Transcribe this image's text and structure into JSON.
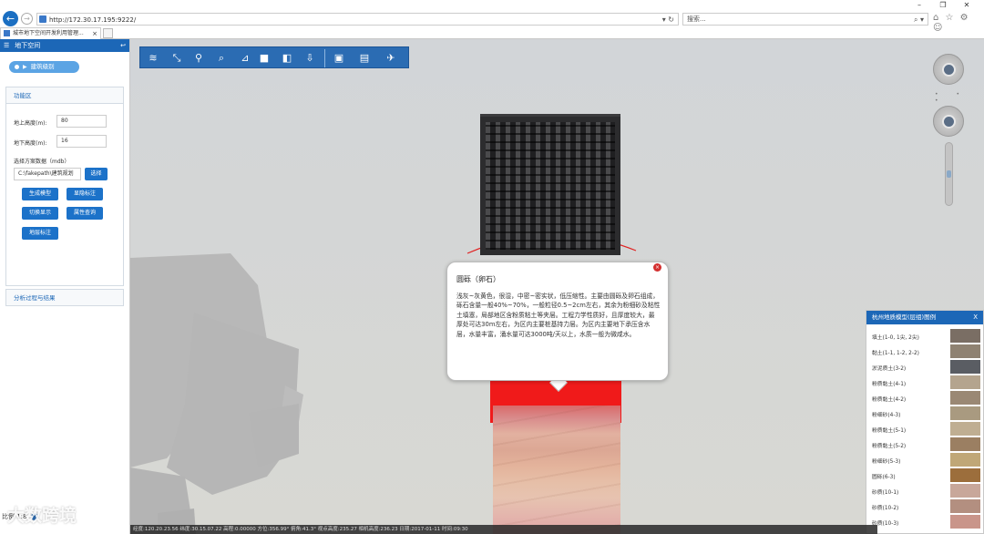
{
  "browser": {
    "url": "http://172.30.17.195:9222/",
    "search_placeholder": "搜索...",
    "tab_title": "城市地下空间开发利用管理...",
    "tab_close": "×",
    "nav_back": "←",
    "nav_forward": "→",
    "address_controls": "▾ ↻",
    "search_controls": "⌕ ▾",
    "toolbar_icons": "⌂ ☆ ⚙ ☺",
    "window_controls": [
      "–",
      "❐",
      "✕"
    ]
  },
  "panel": {
    "title": "地下空间",
    "menu_icon": "☰",
    "back_icon": "↩",
    "tag_button": "建筑级别",
    "section_title": "功能区",
    "above_height_label": "地上高度(m):",
    "above_height_value": "80",
    "below_height_label": "地下高度(m):",
    "below_height_value": "16",
    "file_label": "选择方案数据（mdb）",
    "file_value": "C:\\fakepath\\建筑规划",
    "choose_button": "选择",
    "buttons": [
      "生成模型",
      "显隐标注",
      "切换显示",
      "属性查询",
      "地层标注"
    ],
    "analysis_title": "分析过程与结果"
  },
  "toolbar": {
    "icons": [
      "layers-icon",
      "cursor-icon",
      "broom-icon",
      "magnify-icon",
      "measure-icon",
      "cube-solid-icon",
      "box-icon",
      "download-icon",
      "screen-icon",
      "map-book-icon",
      "airplane-icon"
    ]
  },
  "popup": {
    "close": "×",
    "title": "圆砾（卵石）",
    "body": "浅灰~灰黄色，很湿，中密~密实状，低压缩性。主要由圆砾及卵石组成，砾石含量一般40%~70%，一般粒径0.5~2cm左右，其余为粉细砂及粘性土填塞，局部地区含粉质粘土等夹层。工程力学性质好，且厚度较大，最厚处可达30m左右，为区内主要桩基持力层。为区内主要地下承压含水层，水量丰富，涌水量可达3000吨/天以上，水质一般为微咸水。"
  },
  "legend": {
    "title": "杭州地质模型(层组)图例",
    "close": "X",
    "items": [
      {
        "label": "填土(1-0, 1尖, 2尖)",
        "color": "#7a6e64"
      },
      {
        "label": "黏土(1-1, 1-2, 2-2)",
        "color": "#8f8272"
      },
      {
        "label": "淤泥质土(3-2)",
        "color": "#5a5d63"
      },
      {
        "label": "粉质黏土(4-1)",
        "color": "#b4a48e"
      },
      {
        "label": "粉质黏土(4-2)",
        "color": "#9a8874"
      },
      {
        "label": "粉细砂(4-3)",
        "color": "#a99a80"
      },
      {
        "label": "粉质黏土(5-1)",
        "color": "#bfae92"
      },
      {
        "label": "粉质黏土(5-2)",
        "color": "#9b7f62"
      },
      {
        "label": "粉细砂(5-3)",
        "color": "#c0a777"
      },
      {
        "label": "圆砾(6-3)",
        "color": "#9c6e3c"
      },
      {
        "label": "砂质(10-1)",
        "color": "#c8a79a"
      },
      {
        "label": "砂质(10-2)",
        "color": "#b38f80"
      },
      {
        "label": "砂质(10-3)",
        "color": "#c9958a"
      }
    ]
  },
  "footer": {
    "scale_label": "比例 1:8",
    "status": "经度:120.20.23.56   纬度:30.15.07.22   高程:0.00000   方位:356.99°   俯角:41.3°   视点高度:235.27   相机高度:236.23   日期:2017-01-11   时间:09:30",
    "watermark": "大数跨境"
  }
}
